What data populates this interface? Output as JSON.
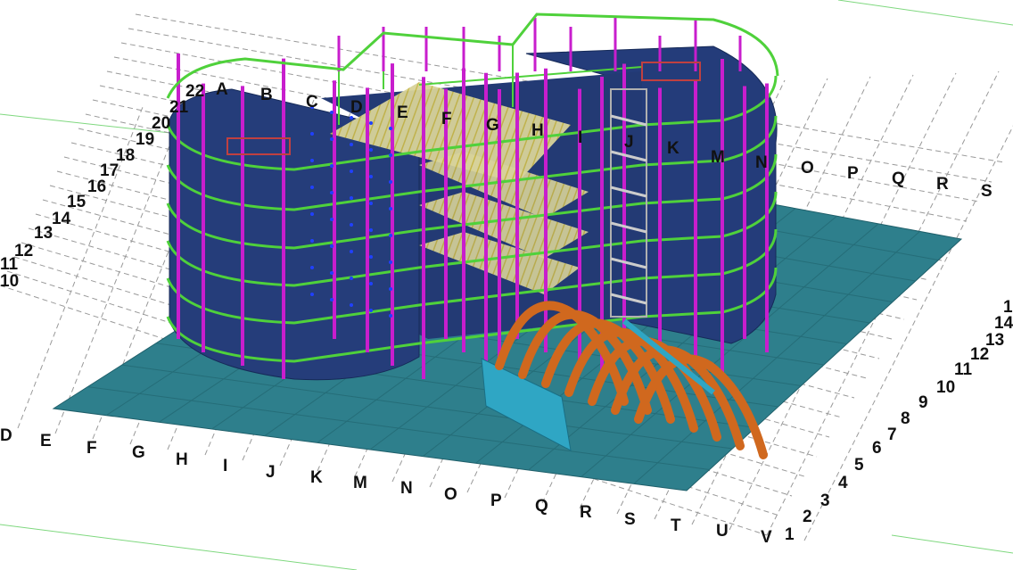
{
  "model_view": {
    "grid_letters_near_top": [
      "A",
      "B",
      "C",
      "D",
      "E",
      "F",
      "G",
      "H",
      "I",
      "J",
      "K",
      "M",
      "N",
      "O",
      "P",
      "Q",
      "R",
      "S"
    ],
    "grid_letters_front": [
      "D",
      "E",
      "F",
      "G",
      "H",
      "I",
      "J",
      "K",
      "M",
      "N",
      "O",
      "P",
      "Q",
      "R",
      "S",
      "T",
      "U",
      "V"
    ],
    "grid_numbers_left": [
      "22",
      "21",
      "20",
      "19",
      "18",
      "17",
      "16",
      "15",
      "14",
      "13",
      "12",
      "11",
      "10"
    ],
    "grid_numbers_right": [
      "1",
      "2",
      "3",
      "4",
      "5",
      "6",
      "7",
      "8",
      "9",
      "10",
      "11",
      "12",
      "13",
      "14",
      "1"
    ],
    "colors": {
      "slab": "#253d7a",
      "column": "#c81ecd",
      "beam": "#4fd13b",
      "ground": "#2e7f8c",
      "ramp": "#f0e070",
      "arch": "#d0681e",
      "grid_line": "#888888",
      "background": "#ffffff"
    }
  }
}
